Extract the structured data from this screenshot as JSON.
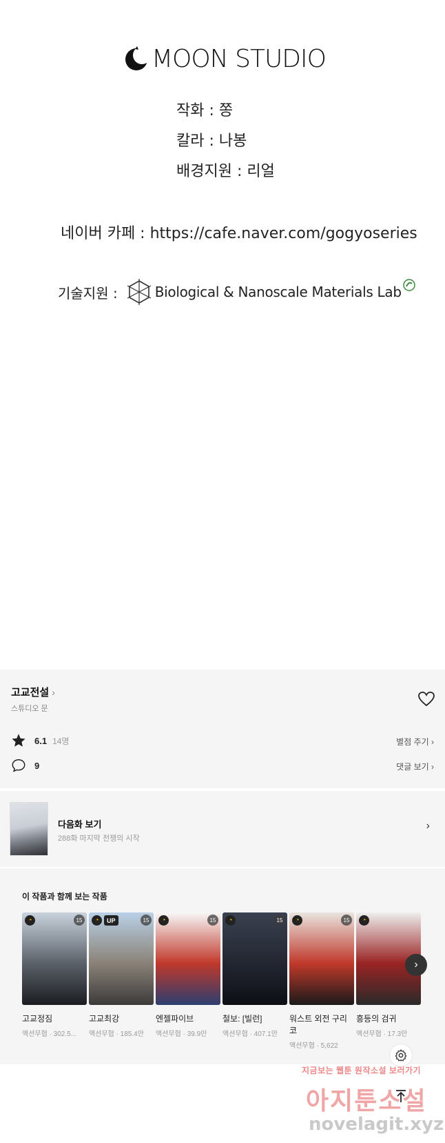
{
  "credits": {
    "logo_text": "MOON STUDIO",
    "artist": "작화 : 쫑",
    "color": "칼라 : 나봉",
    "background": "배경지원 : 리얼",
    "cafe": "네이버 카페 : https://cafe.naver.com/gogyoseries",
    "tech_label": "기술지원 :",
    "lab_name": "Biological & Nanoscale Materials Lab"
  },
  "series": {
    "title": "고교전설",
    "chevron": "›",
    "studio": "스튜디오 문",
    "rating": "6.1",
    "rating_count": "14명",
    "rate_label": "별점 주기 ›",
    "comments": "9",
    "comments_label": "댓글 보기 ›"
  },
  "next_episode": {
    "title": "다음화 보기",
    "subtitle": "288화 마지막 전쟁의 시작",
    "arrow": "›"
  },
  "recommendations": {
    "title": "이 작품과 함께 보는 작품",
    "items": [
      {
        "name": "고교정짐",
        "meta": "액션무협 · 302.5...",
        "up": "",
        "age": "15",
        "colors": [
          "#c9d3dd",
          "#5b6169",
          "#1b1d22"
        ]
      },
      {
        "name": "고교최강",
        "meta": "액션무협 · 185.4만",
        "up": "UP",
        "age": "15",
        "colors": [
          "#b9d0e6",
          "#8a8278",
          "#3c3a3a"
        ]
      },
      {
        "name": "엔젤파이브",
        "meta": "액션무협 · 39.9만",
        "up": "",
        "age": "15",
        "colors": [
          "#f7f7f7",
          "#c0392b",
          "#2c3e70"
        ]
      },
      {
        "name": "철보: [빌런]",
        "meta": "액션무협 · 407.1만",
        "up": "",
        "age": "15",
        "colors": [
          "#3a4150",
          "#222631",
          "#0d0f14"
        ]
      },
      {
        "name": "워스트 외전 구리코",
        "meta": "액션무협 · 5,622",
        "up": "",
        "age": "15",
        "colors": [
          "#e9e4df",
          "#c0392b",
          "#1a1a1a"
        ]
      },
      {
        "name": "흥등의 검귀",
        "meta": "액션무협 · 17.3만",
        "up": "",
        "age": "",
        "colors": [
          "#eeeeee",
          "#9a2323",
          "#2a2a2a"
        ]
      }
    ]
  },
  "watermark": {
    "top": "지금보는 웹툰 원작소설 보러가기",
    "brand": "아지툰소설",
    "url": "novelagit.xyz"
  },
  "icons": {
    "star": "star-icon",
    "heart": "heart-icon",
    "comment": "comment-icon",
    "gear": "gear-icon",
    "top": "arrow-up-icon"
  },
  "colors": {
    "panel_bg": "#f5f5f5",
    "rating_star": "#222222",
    "clock_badge": "#f6c000"
  }
}
